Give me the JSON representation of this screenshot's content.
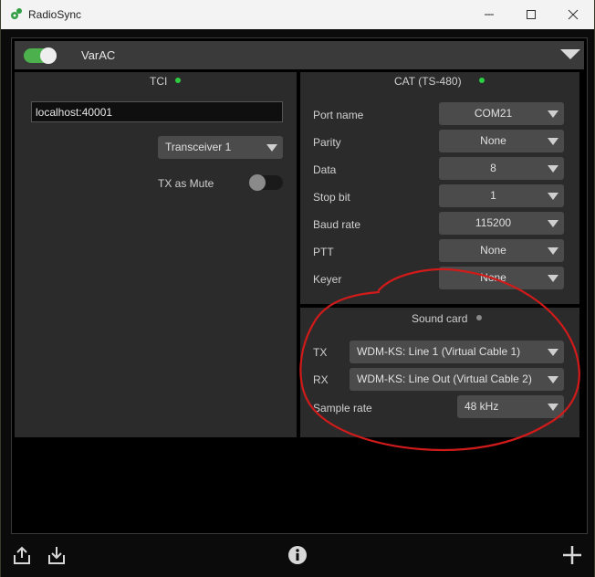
{
  "window": {
    "title": "RadioSync",
    "minimize_label": "—",
    "maximize_label": "☐",
    "close_label": "✕"
  },
  "header": {
    "label": "VarAC",
    "enabled": true
  },
  "tci": {
    "title": "TCI",
    "led_color": "#2ecc40",
    "host_value": "localhost:40001",
    "transceiver": "Transceiver 1",
    "tx_as_mute_label": "TX as Mute",
    "tx_as_mute": false
  },
  "cat": {
    "title": "CAT (TS-480)",
    "led_color": "#2ecc40",
    "rows": [
      {
        "label": "Port name",
        "value": "COM21"
      },
      {
        "label": "Parity",
        "value": "None"
      },
      {
        "label": "Data",
        "value": "8"
      },
      {
        "label": "Stop bit",
        "value": "1"
      },
      {
        "label": "Baud rate",
        "value": "115200"
      },
      {
        "label": "PTT",
        "value": "None"
      },
      {
        "label": "Keyer",
        "value": "None"
      }
    ]
  },
  "sound": {
    "title": "Sound card",
    "led_color": "#8a8a8a",
    "tx_label": "TX",
    "tx_value": "WDM-KS: Line 1 (Virtual Cable 1)",
    "rx_label": "RX",
    "rx_value": "WDM-KS: Line Out (Virtual Cable 2)",
    "sample_rate_label": "Sample rate",
    "sample_rate_value": "48 kHz"
  },
  "annotation_color": "#d11a1a",
  "toolbar": {
    "icons": [
      "export-icon",
      "import-icon",
      "info-icon",
      "add-icon"
    ]
  }
}
